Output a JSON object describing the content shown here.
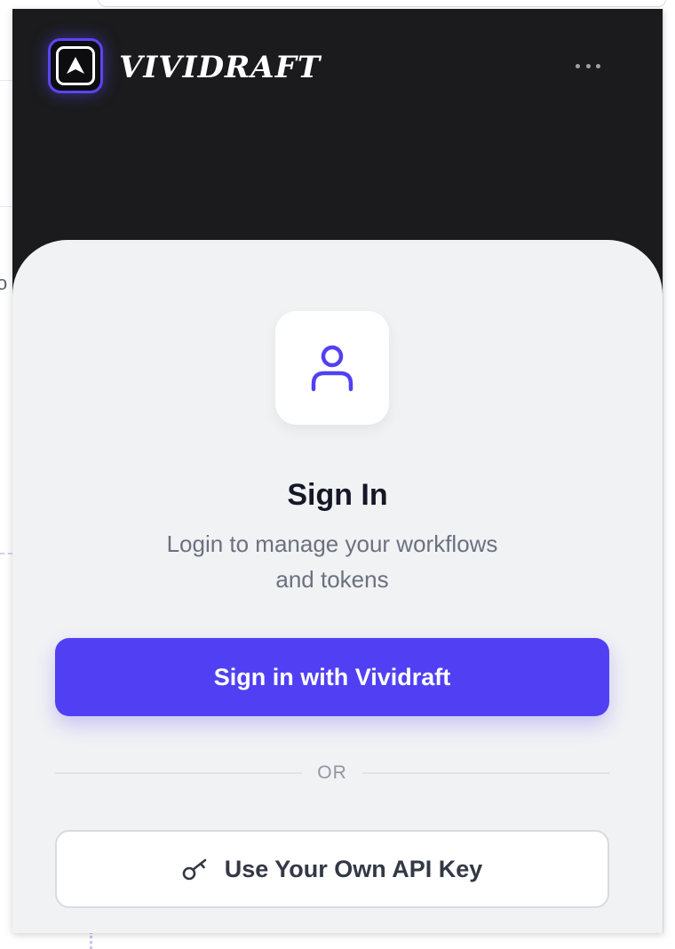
{
  "app": {
    "brand_name": "Vividraft",
    "logo": "vividraft-logo-icon",
    "more_menu_icon": "more-dots-icon"
  },
  "signin": {
    "avatar_icon": "user-icon",
    "title": "Sign In",
    "subtitle": "Login to manage your workflows and tokens",
    "primary_button_label": "Sign in with Vividraft",
    "divider_label": "OR",
    "secondary_button_icon": "key-icon",
    "secondary_button_label": "Use Your Own API Key"
  },
  "background": {
    "partial_text": "o"
  },
  "colors": {
    "accent": "#5140f3",
    "header_bg": "#1b1b1d",
    "card_bg": "#f1f2f4",
    "title_text": "#141826",
    "muted_text": "#6b7180"
  }
}
